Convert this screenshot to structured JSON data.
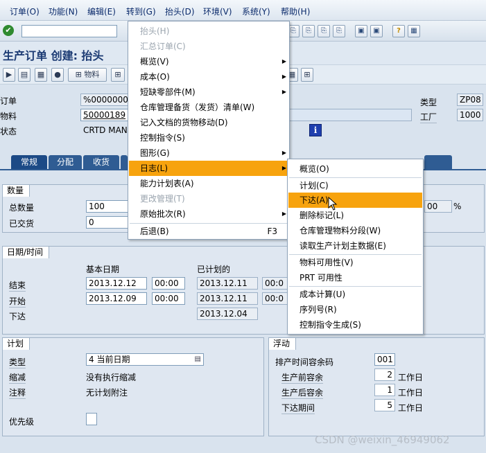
{
  "menubar": [
    "订单(O)",
    "功能(N)",
    "编辑(E)",
    "转到(G)",
    "抬头(D)",
    "环境(V)",
    "系统(Y)",
    "帮助(H)"
  ],
  "page_title": "生产订单 创建: 抬头",
  "app_toolbar": {
    "material_label": "物料"
  },
  "header": {
    "order_label": "订单",
    "order_value": "%0000000",
    "material_label": "物料",
    "material_value": "50000189",
    "status_label": "状态",
    "status_value": "CRTD MANC",
    "type_label": "类型",
    "type_value": "ZP08",
    "plant_label": "工厂",
    "plant_value": "1000"
  },
  "tabs": [
    "常规",
    "分配",
    "收货"
  ],
  "qty": {
    "group_title": "数量",
    "total_label": "总数量",
    "total_value": "100",
    "delivered_label": "已交货",
    "delivered_value": "0",
    "pct_value": "00",
    "pct_unit": "%"
  },
  "dates": {
    "group_title": "日期/时间",
    "col_basic": "基本日期",
    "col_scheduled": "已计划的",
    "rows": [
      {
        "label": "结束",
        "basic_date": "2013.12.12",
        "basic_time": "00:00",
        "sched_date": "2013.12.11",
        "sched_time": "00:0"
      },
      {
        "label": "开始",
        "basic_date": "2013.12.09",
        "basic_time": "00:00",
        "sched_date": "2013.12.11",
        "sched_time": "00:0"
      },
      {
        "label": "下达",
        "sched_date": "2013.12.04"
      }
    ]
  },
  "plan": {
    "group_title": "计划",
    "type_label": "类型",
    "type_value": "4 当前日期",
    "reduce_label": "缩减",
    "reduce_value": "没有执行缩减",
    "note_label": "注释",
    "note_value": "无计划附注",
    "priority_label": "优先级"
  },
  "float": {
    "group_title": "浮动",
    "sm_label": "排产时间容余码",
    "sm_value": "001",
    "before_label": "生产前容余",
    "before_value": "2",
    "before_unit": "工作日",
    "after_label": "生产后容余",
    "after_value": "1",
    "after_unit": "工作日",
    "release_label": "下达期间",
    "release_value": "5",
    "release_unit": "工作日"
  },
  "goto_menu": [
    {
      "label": "抬头(H)",
      "disabled": true,
      "submenu": false
    },
    {
      "label": "汇总订单(C)",
      "disabled": true,
      "submenu": false
    },
    {
      "label": "概览(V)",
      "disabled": false,
      "submenu": true
    },
    {
      "label": "成本(O)",
      "disabled": false,
      "submenu": true
    },
    {
      "label": "短缺零部件(M)",
      "disabled": false,
      "submenu": true
    },
    {
      "label": "仓库管理备货（发货）清单(W)",
      "disabled": false,
      "submenu": false
    },
    {
      "label": "记入文档的货物移动(D)",
      "disabled": false,
      "submenu": false
    },
    {
      "label": "控制指令(S)",
      "disabled": false,
      "submenu": false
    },
    {
      "label": "图形(G)",
      "disabled": false,
      "submenu": true
    },
    {
      "label": "日志(L)",
      "disabled": false,
      "submenu": true,
      "highlight": true
    },
    {
      "label": "能力计划表(A)",
      "disabled": false,
      "submenu": false
    },
    {
      "label": "更改管理(T)",
      "disabled": true,
      "submenu": false
    },
    {
      "label": "原始批次(R)",
      "disabled": false,
      "submenu": true
    },
    {
      "label": "后退(B)",
      "disabled": false,
      "submenu": false,
      "shortcut": "F3"
    }
  ],
  "log_menu": [
    {
      "label": "概览(O)"
    },
    {
      "label": "计划(C)"
    },
    {
      "label": "下达(A)",
      "highlight": true
    },
    {
      "label": "删除标记(L)"
    },
    {
      "label": "仓库管理物料分段(W)"
    },
    {
      "label": "读取生产计划主数据(E)"
    },
    {
      "label": "物料可用性(V)"
    },
    {
      "label": "PRT 可用性"
    },
    {
      "label": "成本计算(U)"
    },
    {
      "label": "序列号(R)"
    },
    {
      "label": "控制指令生成(S)"
    }
  ],
  "watermark": "CSDN @weixin_46949062",
  "colors": {
    "highlight": "#f7a30e",
    "tab": "#2f5c93"
  }
}
